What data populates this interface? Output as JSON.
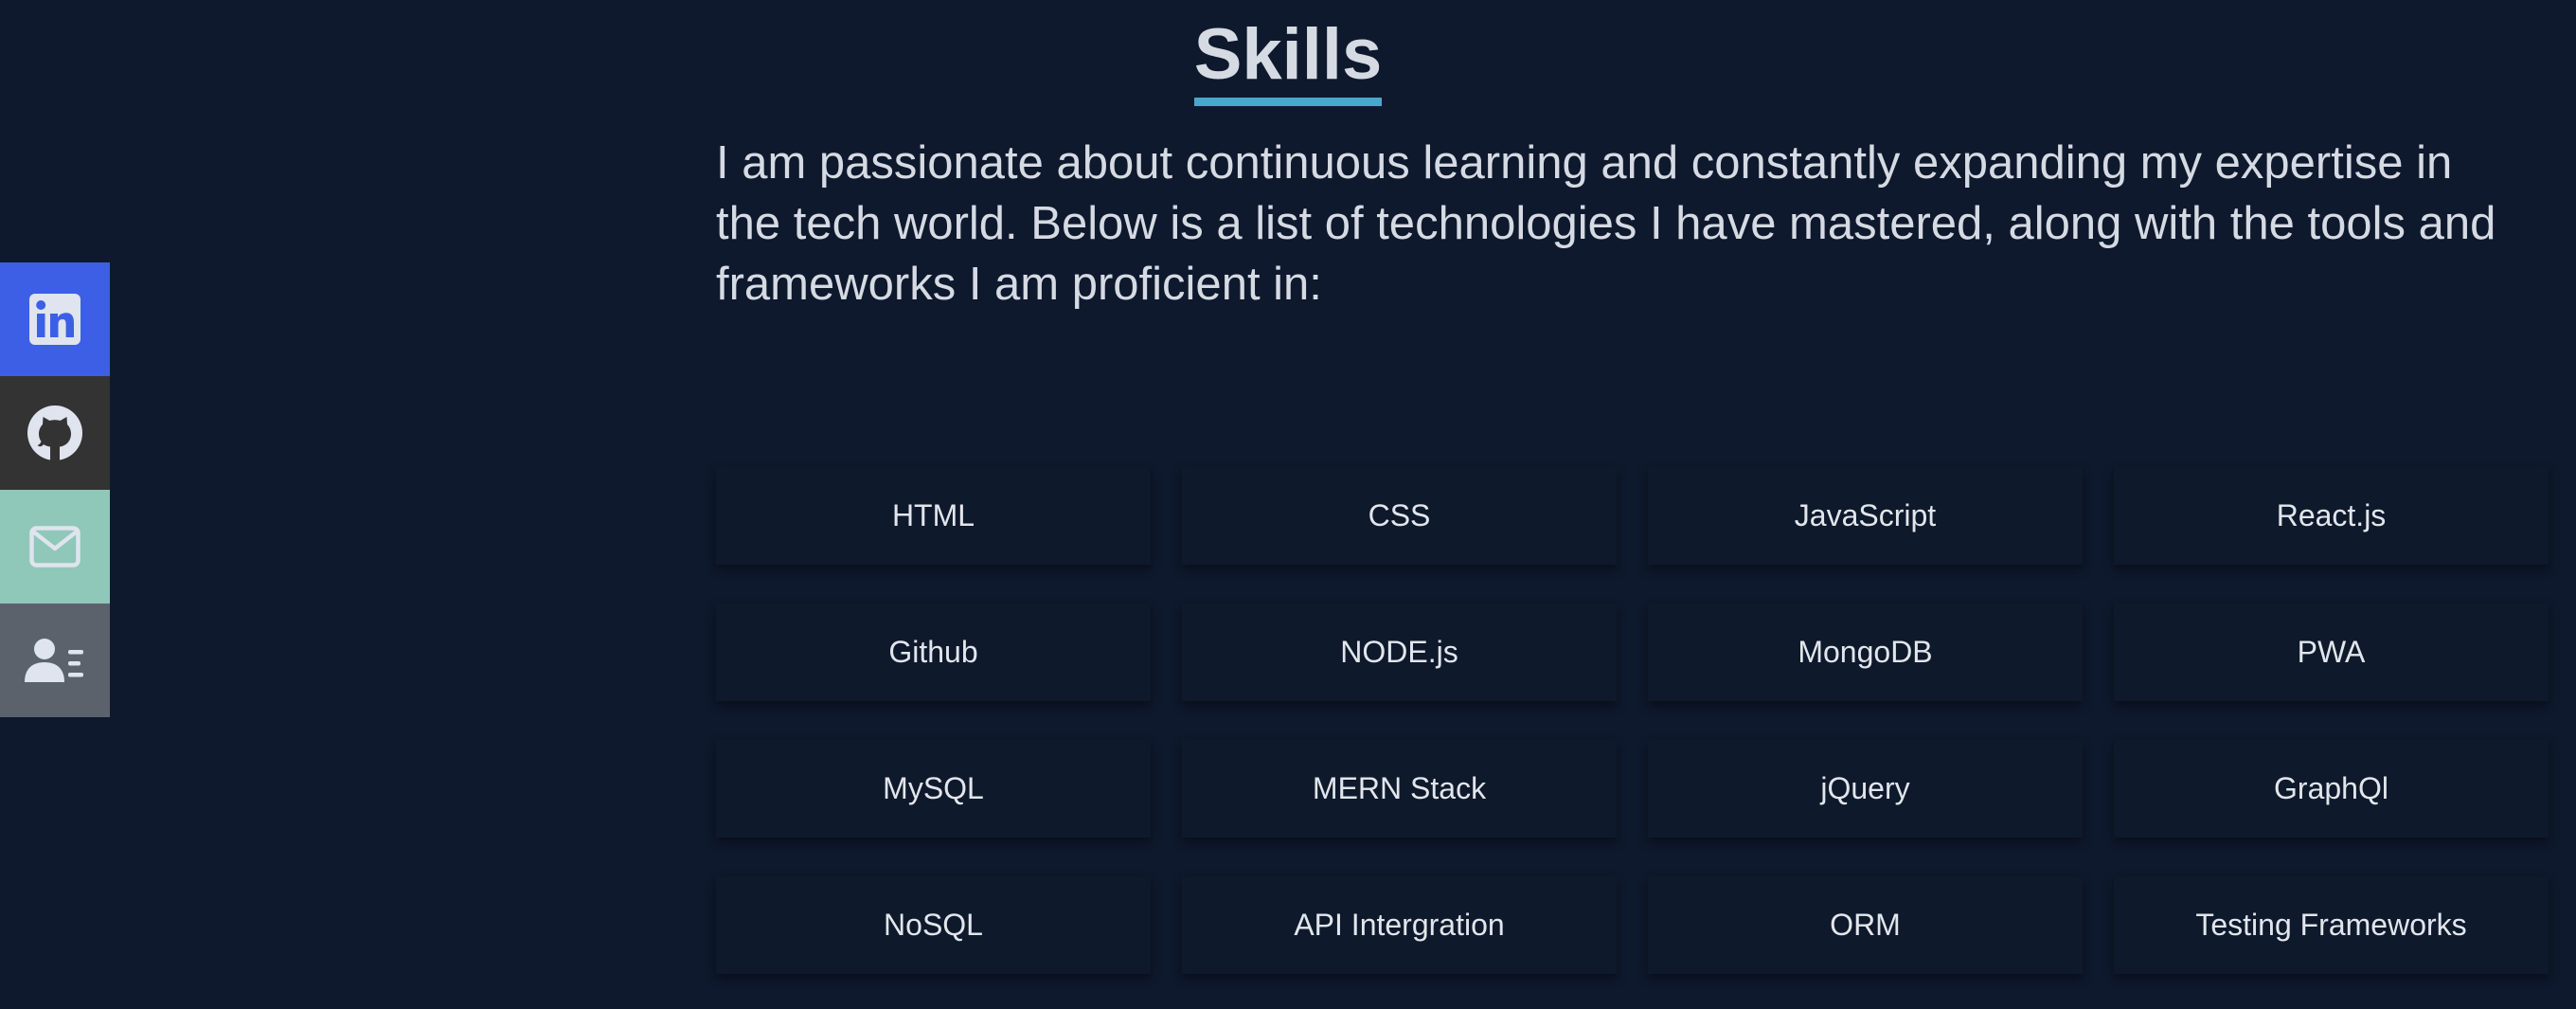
{
  "social": [
    {
      "id": "linkedin",
      "icon": "linkedin-icon",
      "color": "#3c5fe6"
    },
    {
      "id": "github",
      "icon": "github-icon",
      "color": "#333333"
    },
    {
      "id": "email",
      "icon": "mail-icon",
      "color": "#8fc7b9"
    },
    {
      "id": "resume",
      "icon": "contact-card-icon",
      "color": "#5c626c"
    }
  ],
  "skills": {
    "title": "Skills",
    "underline_color": "#47a8cc",
    "intro": "I am passionate about continuous learning and constantly expanding my expertise in the tech world. Below is a list of technologies I have mastered, along with the tools and frameworks I am proficient in:",
    "items": [
      "HTML",
      "CSS",
      "JavaScript",
      "React.js",
      "Github",
      "NODE.js",
      "MongoDB",
      "PWA",
      "MySQL",
      "MERN Stack",
      "jQuery",
      "GraphQl",
      "NoSQL",
      "API Intergration",
      "ORM",
      "Testing Frameworks"
    ]
  }
}
